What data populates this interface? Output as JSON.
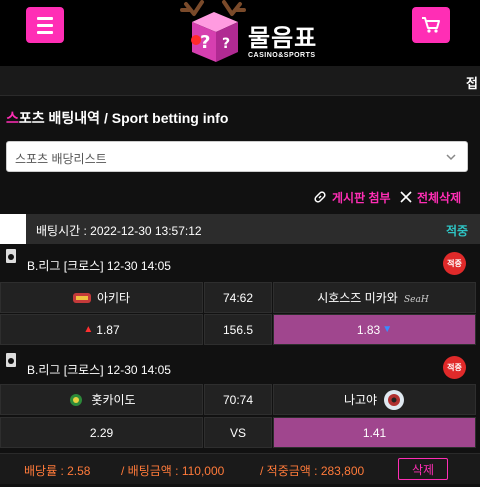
{
  "header": {
    "logo_text": "물음표",
    "logo_sub": "CASINO&SPORTS",
    "subbar_text": "접"
  },
  "page": {
    "title_first": "스",
    "title_rest": "포츠 배팅내역 / Sport betting info"
  },
  "select": {
    "value": "스포츠 배당리스트"
  },
  "actions": {
    "attach_label": "게시판 첨부",
    "delete_all_label": "전체삭제"
  },
  "bet": {
    "time_label": "배팅시간 : 2022-12-30 13:57:12",
    "status": "적중",
    "games": [
      {
        "title": "B.리그  [크로스]  12-30 14:05",
        "badge": "적중",
        "home": "아키타",
        "score": "74:62",
        "away": "시호스즈 미카와",
        "odds_home": "1.87",
        "odds_mid": "156.5",
        "odds_away": "1.83"
      },
      {
        "title": "B.리그  [크로스]  12-30 14:05",
        "badge": "적중",
        "home": "홋카이도",
        "score": "70:74",
        "away": "나고야",
        "odds_home": "2.29",
        "odds_mid": "VS",
        "odds_away": "1.41"
      }
    ]
  },
  "summary": {
    "odds": "배당률 : 2.58",
    "bet_amount": "/ 배팅금액 : 110,000",
    "win_amount": "/ 적중금액 : 283,800",
    "delete_label": "삭제"
  },
  "colors": {
    "accent": "#ff2eb5",
    "status_hit": "#2ec4c4",
    "selected": "#a0468e",
    "summary_text": "#ff7a3a",
    "badge": "#e02a2a"
  }
}
